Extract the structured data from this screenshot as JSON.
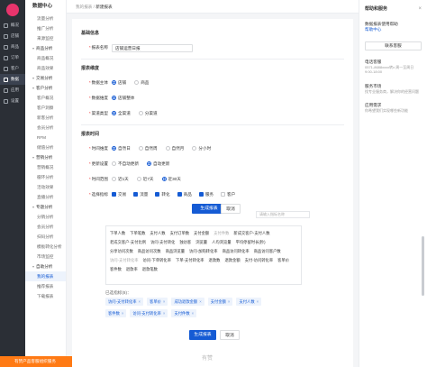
{
  "nav_primary": [
    {
      "label": "概况"
    },
    {
      "label": "店铺"
    },
    {
      "label": "商品"
    },
    {
      "label": "订单"
    },
    {
      "label": "客户"
    },
    {
      "label": "数据",
      "active": true
    },
    {
      "label": "应用"
    },
    {
      "label": "设置"
    }
  ],
  "nav_secondary": {
    "title": "数据中心",
    "items": [
      {
        "label": "流量分析",
        "kind": "sub"
      },
      {
        "label": "推广分析",
        "kind": "sub"
      },
      {
        "label": "来源监控",
        "kind": "sub"
      },
      {
        "label": "商品分析",
        "kind": "sec"
      },
      {
        "label": "商品概况",
        "kind": "sub"
      },
      {
        "label": "商品效果",
        "kind": "sub"
      },
      {
        "label": "交易分析",
        "kind": "sec"
      },
      {
        "label": "客户分析",
        "kind": "sec"
      },
      {
        "label": "客户概况",
        "kind": "sub"
      },
      {
        "label": "客户洞察",
        "kind": "sub"
      },
      {
        "label": "新客分析",
        "kind": "sub"
      },
      {
        "label": "会员分析",
        "kind": "sub"
      },
      {
        "label": "RFM",
        "kind": "sub"
      },
      {
        "label": "储值分析",
        "kind": "sub"
      },
      {
        "label": "营销分析",
        "kind": "sec"
      },
      {
        "label": "营销概况",
        "kind": "sub"
      },
      {
        "label": "循环分析",
        "kind": "sub"
      },
      {
        "label": "活动效果",
        "kind": "sub"
      },
      {
        "label": "直播分析",
        "kind": "sub"
      },
      {
        "label": "专题分析",
        "kind": "sec"
      },
      {
        "label": "分销分析",
        "kind": "sub"
      },
      {
        "label": "会员分析",
        "kind": "sub"
      },
      {
        "label": "扫码分析",
        "kind": "sub"
      },
      {
        "label": "模板转化分析",
        "kind": "sub"
      },
      {
        "label": "市场监控",
        "kind": "sub"
      },
      {
        "label": "自助分析",
        "kind": "sec"
      },
      {
        "label": "我的报表",
        "kind": "sub",
        "active": true
      },
      {
        "label": "推荐报表",
        "kind": "sub"
      },
      {
        "label": "下载报表",
        "kind": "sub"
      }
    ]
  },
  "promo": {
    "label": "有赞产品客服组织服务"
  },
  "breadcrumb": {
    "parent": "我的报表",
    "sep": "/",
    "current": "新建报表"
  },
  "form": {
    "basic_title": "基础信息",
    "name_label": "报表名称",
    "name_value": "店铺运营日报",
    "dim_title": "报表维度",
    "data_subject_label": "数据主体",
    "data_subject_options": [
      {
        "label": "店铺",
        "on": true
      },
      {
        "label": "商品",
        "on": false
      }
    ],
    "data_dim_label": "数据维度",
    "data_dim_options": [
      {
        "label": "店铺整体",
        "on": true
      }
    ],
    "channel_label": "渠道类型",
    "channel_options": [
      {
        "label": "全渠道",
        "on": true
      },
      {
        "label": "分渠道",
        "on": false
      }
    ],
    "time_title": "报表时间",
    "time_dim_label": "时间维度",
    "time_dim_options": [
      {
        "label": "自然日",
        "on": true
      },
      {
        "label": "自然周",
        "on": false
      },
      {
        "label": "自然月",
        "on": false
      },
      {
        "label": "分小时",
        "on": false
      }
    ],
    "update_label": "更新设置",
    "update_options": [
      {
        "label": "不自动更新",
        "on": false
      },
      {
        "label": "自动更新",
        "on": true
      }
    ],
    "range_label": "时间范围",
    "range_options": [
      {
        "label": "近1天",
        "on": false
      },
      {
        "label": "近7天",
        "on": false
      },
      {
        "label": "近30天",
        "on": true
      }
    ],
    "metric_label": "选择指标",
    "metric_options": [
      {
        "label": "交易",
        "on": true
      },
      {
        "label": "流量",
        "on": true
      },
      {
        "label": "转化",
        "on": true
      },
      {
        "label": "商品",
        "on": true
      },
      {
        "label": "服务",
        "on": true
      },
      {
        "label": "客户",
        "on": false
      }
    ]
  },
  "floating_buttons": {
    "primary": "生成报表",
    "secondary": "取消"
  },
  "search_placeholder": "请输入指标名称",
  "metrics_chips": [
    {
      "label": "下单人数",
      "dim": false
    },
    {
      "label": "下单笔数",
      "dim": false
    },
    {
      "label": "支付人数",
      "dim": false
    },
    {
      "label": "支付订单数",
      "dim": false
    },
    {
      "label": "支付金额",
      "dim": false
    },
    {
      "label": "支付件数",
      "dim": true
    },
    {
      "label": "新成交客户-支付人数",
      "dim": false
    },
    {
      "label": "老成交客户-支付比例",
      "dim": false
    },
    {
      "label": "访问-支付转化",
      "dim": false
    },
    {
      "label": "独访客",
      "dim": false
    },
    {
      "label": "浏览量",
      "dim": false
    },
    {
      "label": "人均浏览量",
      "dim": false
    },
    {
      "label": "平均停留时长(秒)",
      "dim": false
    },
    {
      "label": "分享访问次数",
      "dim": false
    },
    {
      "label": "商品访问次数",
      "dim": false
    },
    {
      "label": "商品浏览量",
      "dim": false
    },
    {
      "label": "访问-加购转化率",
      "dim": false
    },
    {
      "label": "商品访问转化率",
      "dim": false
    },
    {
      "label": "商品访问客户数",
      "dim": false
    },
    {
      "label": "访问-支付转化率",
      "dim": true
    },
    {
      "label": "访问-下单转化率",
      "dim": false
    },
    {
      "label": "下单-支付转化率",
      "dim": false
    },
    {
      "label": "退款数",
      "dim": false
    },
    {
      "label": "退款金额",
      "dim": false
    },
    {
      "label": "支付-访问转化率",
      "dim": false
    },
    {
      "label": "客单价",
      "dim": false
    },
    {
      "label": "客件数",
      "dim": false
    },
    {
      "label": "退款率",
      "dim": false
    },
    {
      "label": "退款笔数",
      "dim": false
    }
  ],
  "selected_label": "已选指标(8)：",
  "selected": [
    {
      "label": "访问-支付转化率"
    },
    {
      "label": "客单价"
    },
    {
      "label": "成功退款金额"
    },
    {
      "label": "支付金额"
    },
    {
      "label": "支付人数"
    },
    {
      "label": "客件数"
    },
    {
      "label": "访问-支付转化率"
    },
    {
      "label": "支付件数"
    }
  ],
  "bottom_buttons": {
    "primary": "生成报表",
    "secondary": "取消"
  },
  "watermark": "有赞",
  "help": {
    "title": "帮助和服务",
    "subtitle": "数据报表使用帮助",
    "help_link": "帮助中心",
    "subscribe_label": "联系客服",
    "phone_title": "电话客服",
    "phone_value": "0571-8688xxxx转x 周一至周日 9:00-18:00",
    "market_title": "服务市场",
    "market_desc": "找专业服务商，解决你的经营问题",
    "apply_title": "应用需求",
    "apply_desc": "你希望我们实现哪些新功能"
  }
}
